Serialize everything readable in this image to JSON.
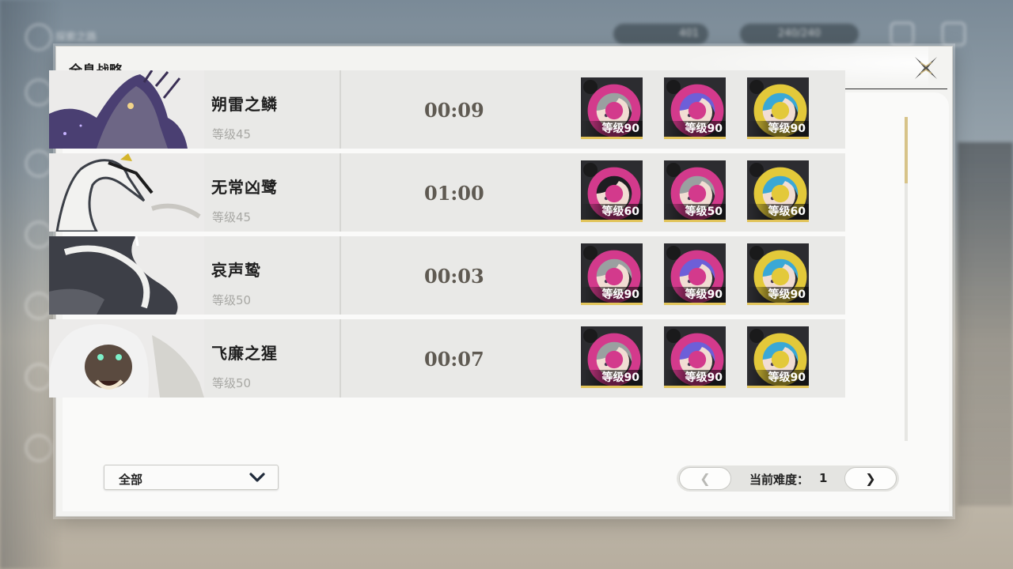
{
  "background_hud": {
    "top_left_label": "探索之路",
    "pill_1": "401",
    "pill_2": "240/240"
  },
  "dialog": {
    "title": "全息战略"
  },
  "rows": [
    {
      "name": "朔雷之鳞",
      "level": "等级45",
      "time": "00:09",
      "portrait_icon": "boss-thunder-scale-portrait",
      "team": [
        {
          "level": "等级90",
          "element": "spectro-element-icon",
          "element_color": "#d33a8c",
          "hair": "#9aa0a0"
        },
        {
          "level": "等级90",
          "element": "spectro-element-icon",
          "element_color": "#d33a8c",
          "hair": "#6d5fd8"
        },
        {
          "level": "等级90",
          "element": "aero-element-icon",
          "element_color": "#e3c93a",
          "hair": "#3aa8d6"
        }
      ]
    },
    {
      "name": "无常凶鹭",
      "level": "等级45",
      "time": "01:00",
      "portrait_icon": "boss-heron-portrait",
      "team": [
        {
          "level": "等级60",
          "element": "spectro-element-icon",
          "element_color": "#d33a8c",
          "hair": "#1e1e22"
        },
        {
          "level": "等级50",
          "element": "spectro-element-icon",
          "element_color": "#d33a8c",
          "hair": "#9aa0a0"
        },
        {
          "level": "等级60",
          "element": "aero-element-icon",
          "element_color": "#e3c93a",
          "hair": "#3aa8d6"
        }
      ]
    },
    {
      "name": "哀声鸷",
      "level": "等级50",
      "time": "00:03",
      "portrait_icon": "boss-mourning-aix-portrait",
      "team": [
        {
          "level": "等级90",
          "element": "spectro-element-icon",
          "element_color": "#d33a8c",
          "hair": "#9aa0a0"
        },
        {
          "level": "等级90",
          "element": "spectro-element-icon",
          "element_color": "#d33a8c",
          "hair": "#6d5fd8"
        },
        {
          "level": "等级90",
          "element": "aero-element-icon",
          "element_color": "#e3c93a",
          "hair": "#3aa8d6"
        }
      ]
    },
    {
      "name": "飞廉之猩",
      "level": "等级50",
      "time": "00:07",
      "portrait_icon": "boss-ape-portrait",
      "team": [
        {
          "level": "等级90",
          "element": "spectro-element-icon",
          "element_color": "#d33a8c",
          "hair": "#9aa0a0"
        },
        {
          "level": "等级90",
          "element": "spectro-element-icon",
          "element_color": "#d33a8c",
          "hair": "#6d5fd8"
        },
        {
          "level": "等级90",
          "element": "aero-element-icon",
          "element_color": "#e3c93a",
          "hair": "#3aa8d6"
        }
      ]
    }
  ],
  "filter": {
    "label": "全部"
  },
  "pager": {
    "prev_label": "❮",
    "next_label": "❯",
    "difficulty_label": "当前难度：",
    "difficulty_value": "1"
  },
  "colors": {
    "accent_gold": "#d7c389",
    "time_text": "#5f5a52"
  }
}
